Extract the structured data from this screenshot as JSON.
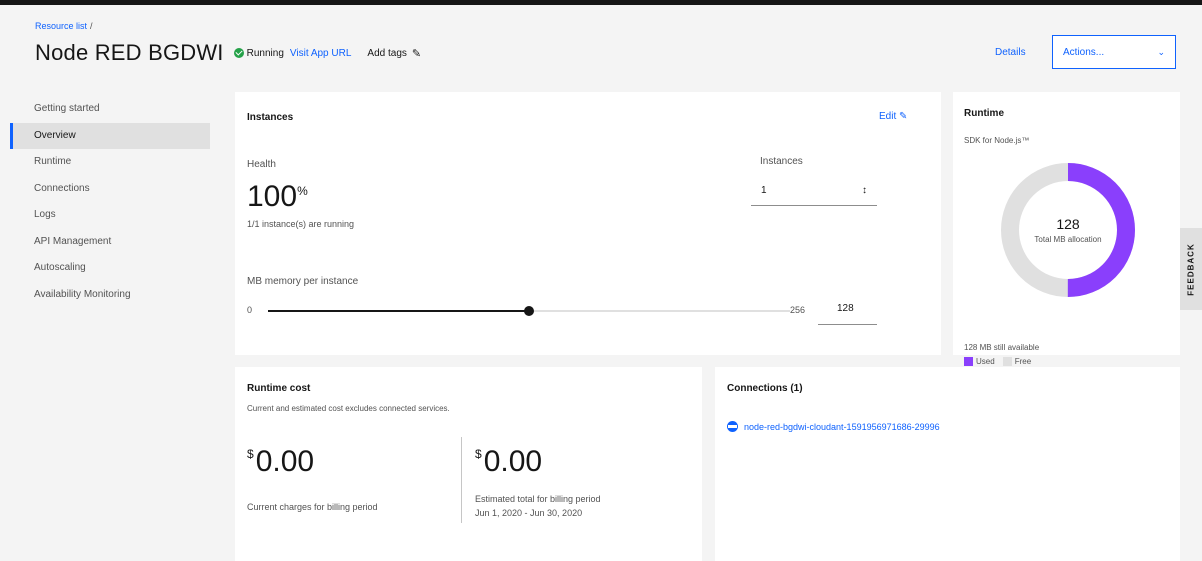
{
  "breadcrumb": {
    "link": "Resource list",
    "separator": "/"
  },
  "header": {
    "title": "Node RED BGDWI",
    "status": "Running",
    "visit_link": "Visit App URL",
    "add_tags": "Add tags",
    "details_link": "Details",
    "actions_label": "Actions..."
  },
  "sidebar": {
    "items": [
      {
        "label": "Getting started"
      },
      {
        "label": "Overview"
      },
      {
        "label": "Runtime"
      },
      {
        "label": "Connections"
      },
      {
        "label": "Logs"
      },
      {
        "label": "API Management"
      },
      {
        "label": "Autoscaling"
      },
      {
        "label": "Availability Monitoring"
      }
    ],
    "active": "Overview"
  },
  "instances": {
    "title": "Instances",
    "edit_label": "Edit",
    "health_label": "Health",
    "health_value": "100",
    "health_unit": "%",
    "running_text": "1/1 instance(s) are running",
    "instances_label": "Instances",
    "instances_value": "1",
    "memory_label": "MB memory per instance",
    "slider_min": "0",
    "slider_max": "256",
    "memory_value": "128",
    "memory_fraction": 0.5
  },
  "runtime": {
    "title": "Runtime",
    "sdk": "SDK for Node.js™",
    "total": "128",
    "total_caption": "Total MB allocation",
    "available_text": "128 MB still available",
    "legend_used": "Used",
    "legend_free": "Free",
    "used_fraction": 0.5,
    "used_color": "#8a3ffc",
    "free_color": "#e0e0e0"
  },
  "feedback": {
    "label": "FEEDBACK"
  },
  "cost": {
    "title": "Runtime cost",
    "subtitle": "Current and estimated cost excludes connected services.",
    "currency": "$",
    "current_value": "0.00",
    "current_caption": "Current charges for billing period",
    "estimated_value": "0.00",
    "estimated_caption": "Estimated total for billing period",
    "estimated_range": "Jun 1, 2020 - Jun 30, 2020"
  },
  "connections": {
    "title": "Connections (1)",
    "items": [
      {
        "label": "node-red-bgdwi-cloudant-1591956971686-29996",
        "icon": "cloudant-icon"
      }
    ]
  },
  "colors": {
    "accent": "#0f62fe",
    "success": "#24a148"
  }
}
